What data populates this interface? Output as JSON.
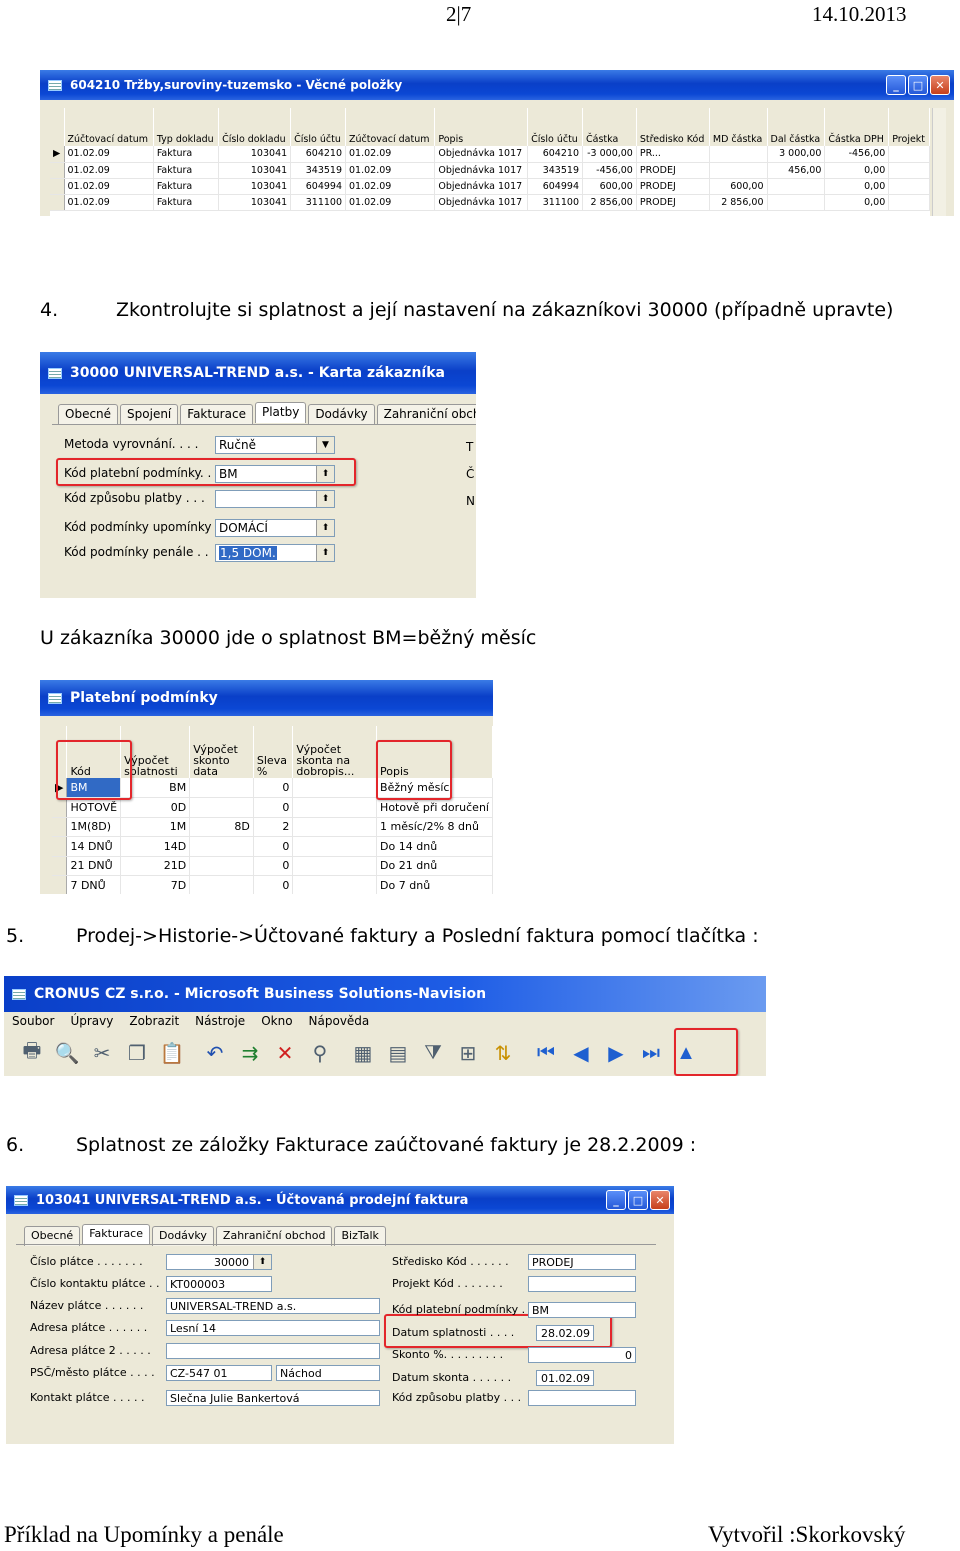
{
  "header": {
    "page": "2|7",
    "date": "14.10.2013"
  },
  "window1": {
    "title": "604210 Tržby,suroviny-tuzemsko - Věcné položky",
    "columns": [
      "Zúčtovací datum",
      "Typ dokladu",
      "Číslo dokladu",
      "Číslo účtu",
      "Zúčtovací datum",
      "Popis",
      "Číslo účtu",
      "Částka",
      "Středisko Kód",
      "MD částka",
      "Dal částka",
      "Částka DPH",
      "Projekt"
    ],
    "rows": [
      [
        "01.02.09",
        "Faktura",
        "103041",
        "604210",
        "01.02.09",
        "Objednávka 1017",
        "604210",
        "-3 000,00",
        "PR...",
        "",
        "3 000,00",
        "-456,00",
        ""
      ],
      [
        "01.02.09",
        "Faktura",
        "103041",
        "343519",
        "01.02.09",
        "Objednávka 1017",
        "343519",
        "-456,00",
        "PRODEJ",
        "",
        "456,00",
        "0,00",
        ""
      ],
      [
        "01.02.09",
        "Faktura",
        "103041",
        "604994",
        "01.02.09",
        "Objednávka 1017",
        "604994",
        "600,00",
        "PRODEJ",
        "600,00",
        "",
        "0,00",
        ""
      ],
      [
        "01.02.09",
        "Faktura",
        "103041",
        "311100",
        "01.02.09",
        "Objednávka 1017",
        "311100",
        "2 856,00",
        "PRODEJ",
        "2 856,00",
        "",
        "0,00",
        ""
      ]
    ]
  },
  "step4": {
    "number": "4.",
    "text": "Zkontrolujte si splatnost a její nastavení na zákazníkovi  30000 (případně upravte)"
  },
  "window2": {
    "title": "30000 UNIVERSAL-TREND a.s. - Karta zákazníka",
    "tabs": [
      "Obecné",
      "Spojení",
      "Fakturace",
      "Platby",
      "Dodávky",
      "Zahraniční obchod"
    ],
    "fields": [
      {
        "label": "Metoda vyrovnání. . . .",
        "value": "Ručně"
      },
      {
        "label": "Kód platební podmínky. .",
        "value": "BM"
      },
      {
        "label": "Kód způsobu platby . . .",
        "value": ""
      },
      {
        "label": "Kód podmínky upomínky .",
        "value": "DOMÁCÍ"
      },
      {
        "label": "Kód podmínky penále  . .",
        "value": "1,5 DOM."
      }
    ],
    "right_letters": [
      "T",
      "Č",
      "N"
    ]
  },
  "note1": "U zákazníka 30000 jde o splatnost BM=běžný měsíc",
  "window3": {
    "title": "Platební podmínky",
    "columns": [
      "Kód",
      "Výpočet splatnosti",
      "Výpočet skonto data",
      "Sleva %",
      "Výpočet skonta na dobropis...",
      "Popis"
    ],
    "rows": [
      [
        "BM",
        "BM",
        "",
        "0",
        "",
        "Běžný měsíc"
      ],
      [
        "HOTOVĚ",
        "0D",
        "",
        "0",
        "",
        "Hotově při doručení"
      ],
      [
        "1M(8D)",
        "1M",
        "8D",
        "2",
        "",
        "1 měsíc/2% 8 dnů"
      ],
      [
        "14 DNŮ",
        "14D",
        "",
        "0",
        "",
        "Do 14 dnů"
      ],
      [
        "21 DNŮ",
        "21D",
        "",
        "0",
        "",
        "Do 21 dnů"
      ],
      [
        "7 DNŮ",
        "7D",
        "",
        "0",
        "",
        "Do 7 dnů"
      ]
    ]
  },
  "step5": {
    "number": "5.",
    "text": "Prodej->Historie->Účtované faktury a Poslední faktura pomocí tlačítka :"
  },
  "window4": {
    "title": "CRONUS CZ s.r.o. - Microsoft Business Solutions-Navision",
    "menu": [
      "Soubor",
      "Úpravy",
      "Zobrazit",
      "Nástroje",
      "Okno",
      "Nápověda"
    ],
    "toolbar_icons": [
      "print-icon",
      "preview-icon",
      "cut-icon",
      "copy-icon",
      "paste-icon",
      "undo-icon",
      "post-icon",
      "delete-icon",
      "find-icon",
      "table-icon",
      "form-icon",
      "filter-icon",
      "sort-icon",
      "refresh-icon",
      "first-icon",
      "previous-icon",
      "next-icon",
      "last-icon",
      "up-icon"
    ]
  },
  "step6": {
    "number": "6.",
    "text": "Splatnost ze záložky Fakturace zaúčtované faktury je   28.2.2009 :"
  },
  "window5": {
    "title": "103041 UNIVERSAL-TREND a.s. - Účtovaná prodejní faktura",
    "tabs": [
      "Obecné",
      "Fakturace",
      "Dodávky",
      "Zahraniční obchod",
      "BizTalk"
    ],
    "left_fields": [
      {
        "label": "Číslo plátce . . . . . . .",
        "value": "30000"
      },
      {
        "label": "Číslo kontaktu plátce  . .",
        "value": "KT000003"
      },
      {
        "label": "Název plátce . . . . . .",
        "value": "UNIVERSAL-TREND a.s."
      },
      {
        "label": "Adresa plátce . . . . . .",
        "value": "Lesní 14"
      },
      {
        "label": "Adresa plátce 2 . . . . .",
        "value": ""
      },
      {
        "label": "PSČ/město plátce . . . .",
        "value": "CZ-547 01",
        "value2": "Náchod"
      },
      {
        "label": "Kontakt plátce  . . . . .",
        "value": "Slečna Julie Bankertová"
      }
    ],
    "right_fields": [
      {
        "label": "Středisko Kód . . . . . .",
        "value": "PRODEJ"
      },
      {
        "label": "Projekt Kód . . . . . . .",
        "value": ""
      },
      {
        "label": "Kód platební podmínky . .",
        "value": "BM"
      },
      {
        "label": "Datum splatnosti  . . . .",
        "value": "28.02.09"
      },
      {
        "label": "Skonto %. . . . . . . . .",
        "value": "0"
      },
      {
        "label": "Datum skonta . . . . . .",
        "value": "01.02.09"
      },
      {
        "label": "Kód způsobu platby . . .",
        "value": ""
      }
    ]
  },
  "footer": {
    "left": "Příklad na Upomínky a penále",
    "right": "Vytvořil :Skorkovský"
  }
}
